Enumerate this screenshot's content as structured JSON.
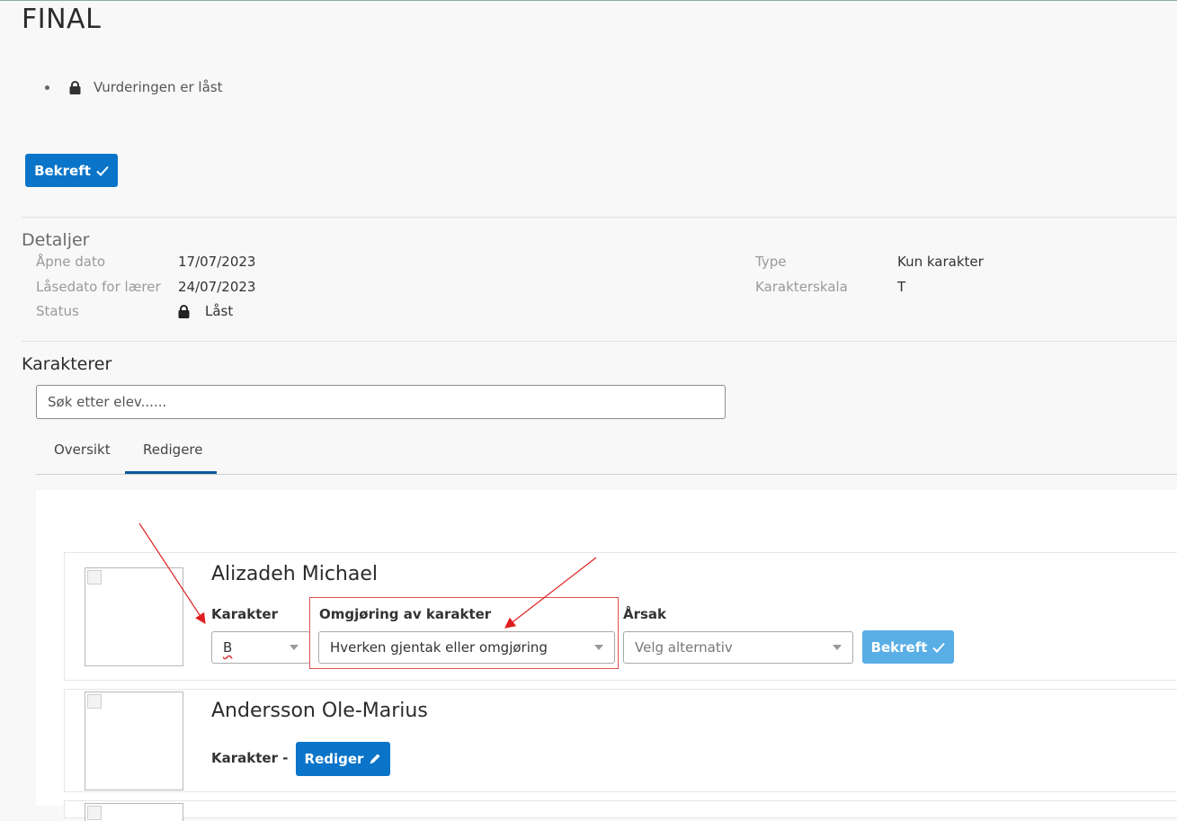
{
  "page": {
    "title": "FINAL",
    "lock_status": "Vurderingen er låst"
  },
  "actions": {
    "confirm_label": "Bekreft"
  },
  "details": {
    "title": "Detaljer",
    "left": [
      {
        "label": "Åpne dato",
        "value": "17/07/2023"
      },
      {
        "label": "Låsedato for lærer",
        "value": "24/07/2023"
      },
      {
        "label": "Status",
        "value": "Låst"
      }
    ],
    "right": [
      {
        "label": "Type",
        "value": "Kun karakter"
      },
      {
        "label": "Karakterskala",
        "value": "T"
      }
    ]
  },
  "grades": {
    "title": "Karakterer",
    "search_placeholder": "Søk etter elev......",
    "tabs": [
      {
        "label": "Oversikt"
      },
      {
        "label": "Redigere"
      }
    ],
    "students": [
      {
        "name": "Alizadeh Michael",
        "grade_label": "Karakter",
        "grade_value": "B",
        "change_label": "Omgjøring av karakter",
        "change_value": "Hverken gjentak eller omgjøring",
        "reason_label": "Årsak",
        "reason_placeholder": "Velg alternativ",
        "confirm_label": "Bekreft"
      },
      {
        "name": "Andersson Ole-Marius",
        "grade_text": "Karakter -",
        "edit_label": "Rediger"
      }
    ]
  },
  "colors": {
    "primary": "#0a74c9",
    "primary_light": "#5aaee6",
    "annotation": "#e02020"
  }
}
